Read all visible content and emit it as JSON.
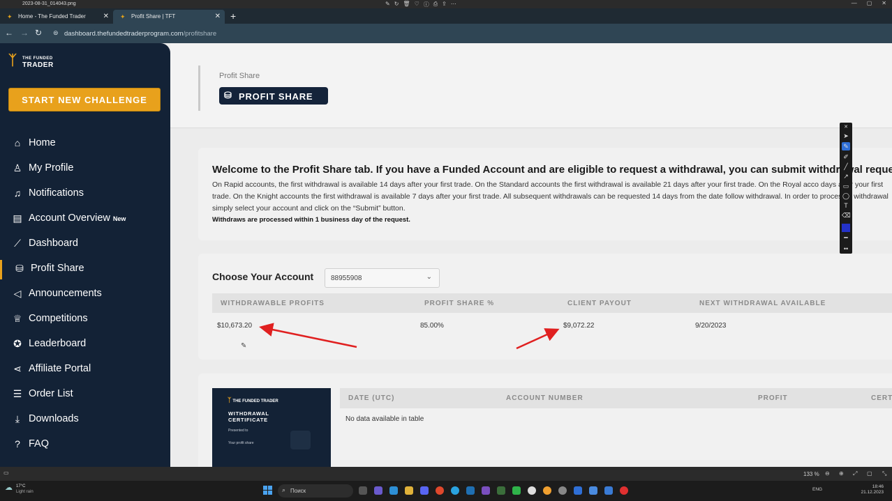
{
  "window": {
    "filename": "2023-08-31_014043.png",
    "tabs": [
      {
        "title": "Home - The Funded Trader"
      },
      {
        "title": "Profit Share | TFT"
      }
    ],
    "address": {
      "host": "dashboard.thefundedtraderprogram.com",
      "path": "/profitshare"
    }
  },
  "sidebar": {
    "logo": {
      "line1": "THE FUNDED",
      "line2": "TRADER"
    },
    "cta_label": "START NEW CHALLENGE",
    "items": [
      {
        "label": "Home",
        "icon": "home-icon"
      },
      {
        "label": "My Profile",
        "icon": "user-icon"
      },
      {
        "label": "Notifications",
        "icon": "bell-icon"
      },
      {
        "label": "Account Overview",
        "icon": "table-icon",
        "badge": "New"
      },
      {
        "label": "Dashboard",
        "icon": "chart-line-icon"
      },
      {
        "label": "Profit Share",
        "icon": "coins-icon",
        "active": true
      },
      {
        "label": "Announcements",
        "icon": "megaphone-icon"
      },
      {
        "label": "Competitions",
        "icon": "trophy-icon"
      },
      {
        "label": "Leaderboard",
        "icon": "medal-icon"
      },
      {
        "label": "Affiliate Portal",
        "icon": "share-icon"
      },
      {
        "label": "Order List",
        "icon": "list-icon"
      },
      {
        "label": "Downloads",
        "icon": "download-icon"
      },
      {
        "label": "FAQ",
        "icon": "question-icon"
      }
    ]
  },
  "header": {
    "breadcrumb": "Profit Share",
    "title": "PROFIT SHARE"
  },
  "welcome": {
    "heading": "Welcome to the Profit Share tab. If you have a Funded Account and are eligible to request a withdrawal, you can submit withdrawal requests h",
    "body": "On Rapid accounts, the first withdrawal is available 14 days after your first trade. On the Standard accounts the first withdrawal is available 21 days after your first trade. On the Royal acco days after your first trade. On the Knight accounts the first withdrawal is available 7 days after your first trade. All subsequent withdrawals can be requested 14 days from the date follow withdrawal. In order to process a withdrawal simply select your account and click on the “Submit” button.",
    "note": "Withdraws are processed within 1 business day of the request."
  },
  "account": {
    "label": "Choose Your Account",
    "selected": "88955908",
    "columns": [
      "WITHDRAWABLE PROFITS",
      "PROFIT SHARE %",
      "CLIENT PAYOUT",
      "NEXT WITHDRAWAL AVAILABLE"
    ],
    "row": [
      "$10,673.20",
      "85.00%",
      "$9,072.22",
      "9/20/2023"
    ]
  },
  "withdrawals": {
    "certificate": {
      "logo": "THE FUNDED TRADER",
      "title": "WITHDRAWAL CERTIFICATE",
      "presented": "Presented to",
      "profit": "Your profit share"
    },
    "columns": [
      "DATE (UTC)",
      "ACCOUNT NUMBER",
      "PROFIT",
      "CERT"
    ],
    "empty_text": "No data available in table"
  },
  "statusbar": {
    "zoom": "133 %"
  },
  "taskbar": {
    "weather_temp": "17°C",
    "weather_desc": "Light rain",
    "search_placeholder": "Поиск",
    "lang": "ENG",
    "time": "18:46",
    "date": "21.12.2023"
  },
  "colors": {
    "sidebar": "#132236",
    "accent": "#e8a11c",
    "arrow": "#e02020"
  }
}
